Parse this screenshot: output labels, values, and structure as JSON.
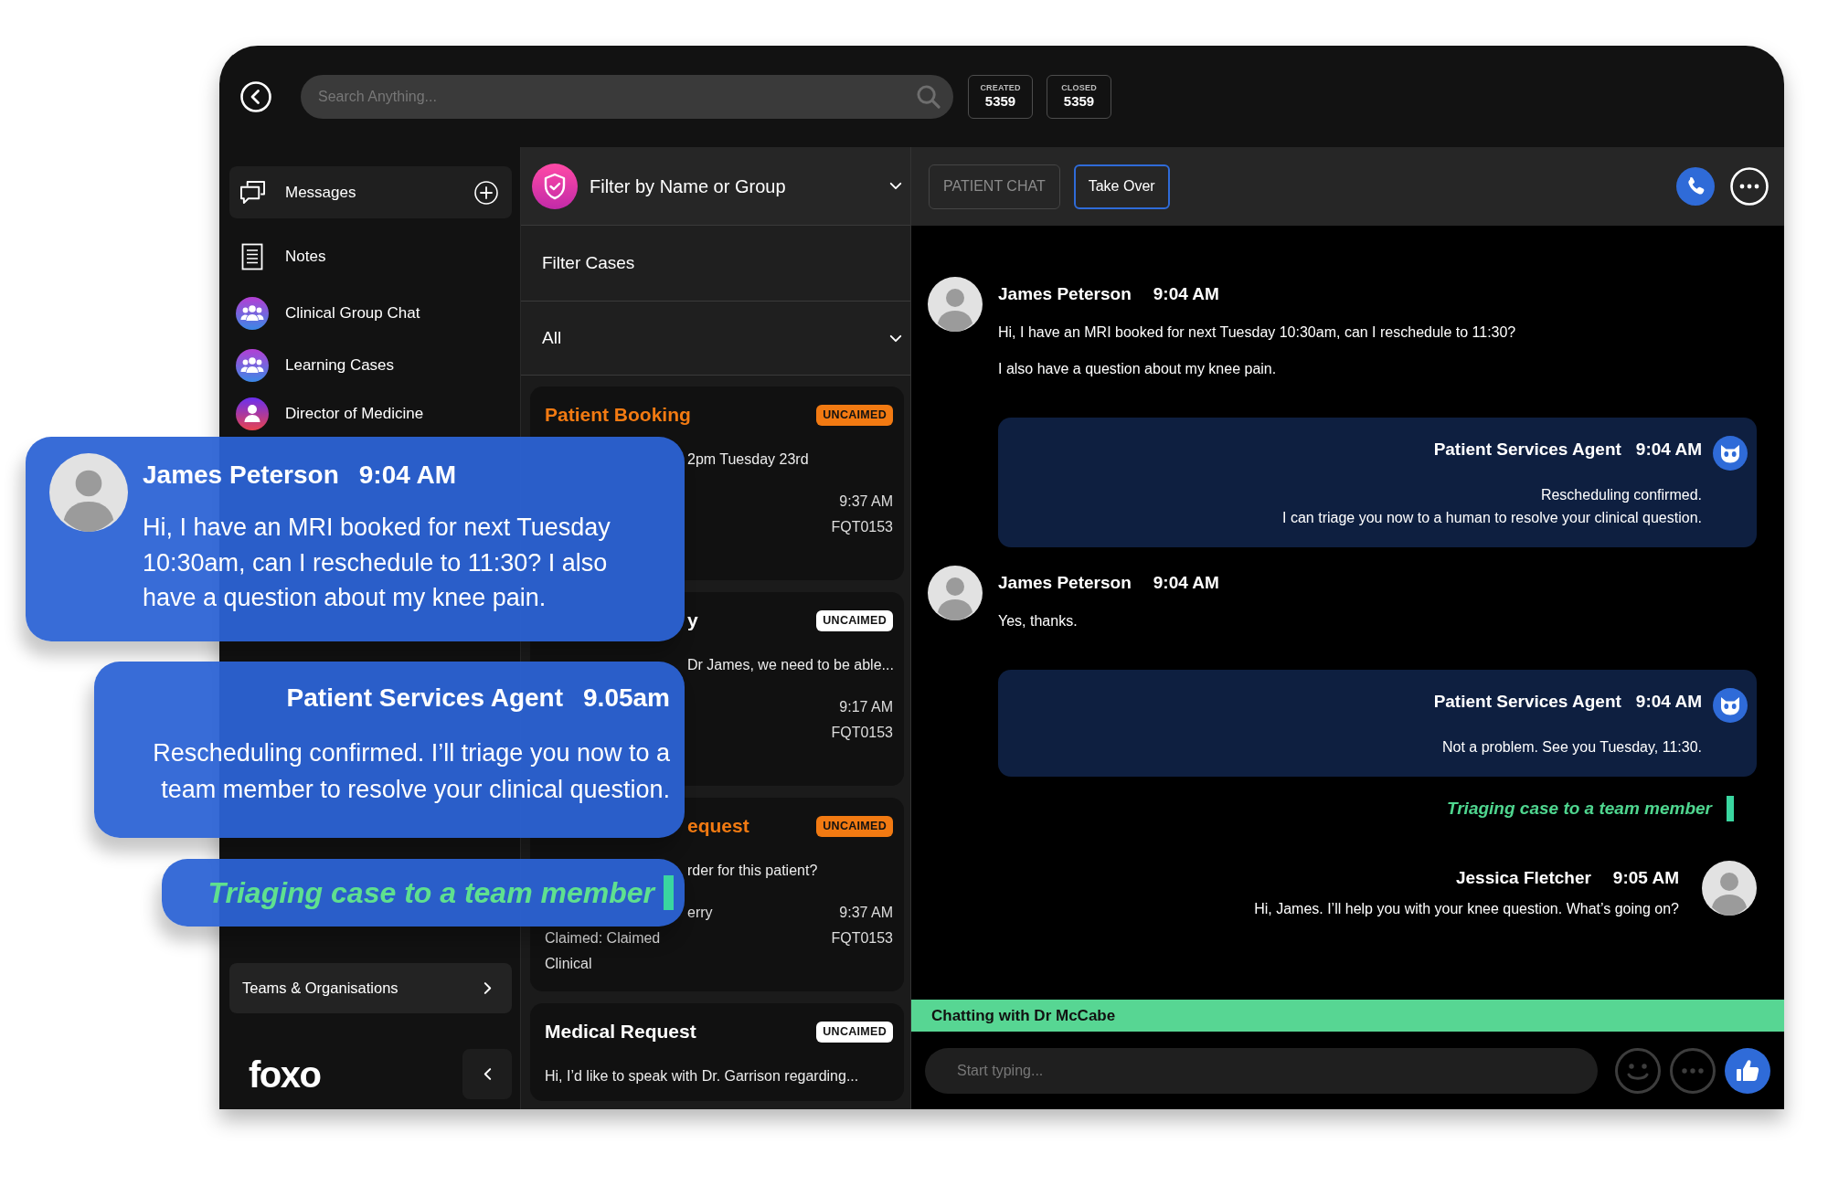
{
  "top_bar": {
    "search": {
      "placeholder": "Search Anything..."
    },
    "counters": [
      {
        "label": "CREATED",
        "value": "5359"
      },
      {
        "label": "CLOSED",
        "value": "5359"
      }
    ]
  },
  "sidebar": {
    "items": [
      {
        "kind": "messages",
        "label": "Messages",
        "selected": true
      },
      {
        "kind": "notes",
        "label": "Notes",
        "selected": false
      },
      {
        "kind": "group",
        "label": "Clinical Group Chat",
        "selected": false
      },
      {
        "kind": "group",
        "label": "Learning Cases",
        "selected": false
      },
      {
        "kind": "person",
        "label": "Director of Medicine",
        "selected": false
      }
    ],
    "footer_button": "Teams & Organisations",
    "logo": "foxo"
  },
  "cases": {
    "group_filter": "Filter by Name or Group",
    "filter_label": "Filter Cases",
    "scope": "All",
    "items": [
      {
        "title": "Patient Booking",
        "badge": "UNCAIMED",
        "color": "#f27a12",
        "summary": {
          "text": "2pm Tuesday 23rd",
          "covered": true
        },
        "meta": [
          {
            "right": "9:37 AM"
          },
          {
            "right": "FQT0153"
          }
        ]
      },
      {
        "title": {
          "text": "y",
          "covered": true
        },
        "badge": "UNCAIMED",
        "color": "#ffffff",
        "summary": {
          "text": "Dr James, we need to be able...",
          "covered": true
        },
        "meta": [
          {
            "right": "9:17 AM"
          },
          {
            "right": "FQT0153"
          }
        ]
      },
      {
        "title": {
          "text": "equest",
          "covered": true
        },
        "badge": "UNCAIMED",
        "color": "#f27a12",
        "summary": {
          "text": "rder for this patient?",
          "covered": true
        },
        "meta": [
          {
            "left": {
              "text": "erry",
              "covered": true
            },
            "right": "9:37 AM"
          },
          {
            "left": "Claimed: Claimed",
            "right": "FQT0153"
          },
          {
            "left": "Clinical"
          }
        ]
      },
      {
        "title": "Medical Request",
        "badge": "UNCAIMED",
        "color": "#ffffff",
        "summary": "Hi, I’d like to speak with Dr. Garrison regarding..."
      }
    ]
  },
  "chat": {
    "header_buttons": [
      {
        "label": "PATIENT CHAT",
        "disabled": true
      },
      {
        "label": "Take Over",
        "disabled": false
      }
    ],
    "messages": [
      {
        "kind": "patient",
        "sender": "James Peterson",
        "time": "9:04 AM",
        "lines": [
          "Hi, I have an MRI booked for next Tuesday 10:30am, can I reschedule to 11:30?",
          "I also have a question about my knee pain."
        ]
      },
      {
        "kind": "agent",
        "sender": "Patient Services Agent",
        "time": "9:04 AM",
        "lines": [
          "Rescheduling confirmed.",
          "I can triage you now to a human to resolve your clinical question."
        ]
      },
      {
        "kind": "patient",
        "sender": "James Peterson",
        "time": "9:04 AM",
        "lines": [
          "Yes, thanks."
        ]
      },
      {
        "kind": "agent",
        "sender": "Patient Services Agent",
        "time": "9:04 AM",
        "lines": [
          "Not a problem. See you Tuesday, 11:30."
        ]
      },
      {
        "kind": "status",
        "text": "Triaging case to a team member"
      },
      {
        "kind": "staff",
        "sender": "Jessica Fletcher",
        "time": "9:05 AM",
        "lines": [
          "Hi, James. I’ll help you with your knee question. What’s going on?"
        ]
      }
    ],
    "banner": "Chatting with Dr McCabe",
    "composer": {
      "placeholder": "Start typing..."
    }
  },
  "callouts": [
    {
      "kind": "patient",
      "sender": "James Peterson",
      "time": "9:04 AM",
      "text": "Hi, I have an MRI booked for next Tuesday 10:30am, can I reschedule to 11:30? I also have a question about my knee pain."
    },
    {
      "kind": "agent",
      "sender": "Patient Services Agent",
      "time": "9.05am",
      "text": "Rescheduling confirmed. I’ll triage you now to a team member to resolve your clinical question."
    },
    {
      "kind": "status",
      "text": "Triaging case to a team member"
    }
  ]
}
